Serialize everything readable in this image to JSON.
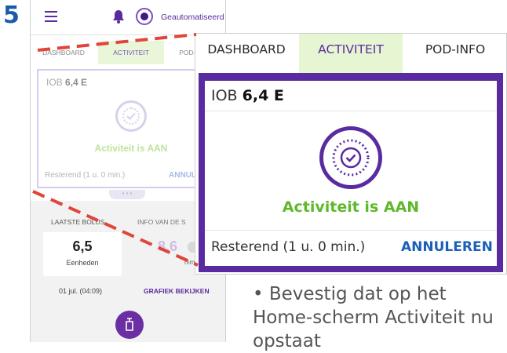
{
  "step_number": "5",
  "phone": {
    "header": {
      "mode_label": "Geautomatiseerd"
    },
    "tabs": [
      "DASHBOARD",
      "ACTIVITEIT",
      "POD-INFO"
    ],
    "activity_card": {
      "iob_label": "IOB",
      "iob_value": "6,4 E",
      "status": "Activiteit is AAN",
      "remaining": "Resterend (1 u. 0 min.)",
      "cancel": "ANNULEREN"
    },
    "last_bolus": {
      "label": "LAATSTE BOLUS",
      "value": "6,5",
      "unit": "Eenheden",
      "date": "01 jul. (04:09)"
    },
    "bg_info": {
      "label": "INFO VAN DE S",
      "value": "8,6",
      "unit": "mmol/",
      "graph_link": "GRAFIEK BEKIJKEN"
    }
  },
  "zoom": {
    "tabs": [
      "DASHBOARD",
      "ACTIVITEIT",
      "POD-INFO"
    ],
    "active_tab": "ACTIVITEIT",
    "iob_label": "IOB",
    "iob_value": "6,4 E",
    "status": "Activiteit is AAN",
    "remaining": "Resterend (1 u. 0 min.)",
    "cancel": "ANNULEREN"
  },
  "instruction": "• Bevestig dat op het Home-scherm Activiteit nu opstaat",
  "colors": {
    "purple": "#5a2ba0",
    "green_status": "#5fb82b",
    "link_blue": "#1b5fb8",
    "tab_active_bg": "#e6f5d2",
    "step_blue": "#1a5aa6",
    "dash_red": "#e0453a"
  }
}
